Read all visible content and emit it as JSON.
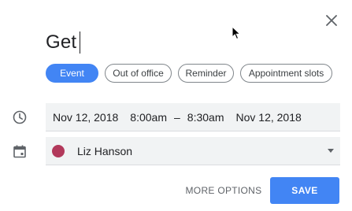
{
  "header": {
    "close_icon": "close-icon"
  },
  "event": {
    "title": "Get"
  },
  "event_types": [
    {
      "label": "Event",
      "active": true
    },
    {
      "label": "Out of office",
      "active": false
    },
    {
      "label": "Reminder",
      "active": false
    },
    {
      "label": "Appointment slots",
      "active": false
    }
  ],
  "datetime": {
    "icon": "clock-icon",
    "start_date": "Nov 12, 2018",
    "start_time": "8:00am",
    "separator": "–",
    "end_time": "8:30am",
    "end_date": "Nov 12, 2018"
  },
  "calendar": {
    "icon": "calendar-icon",
    "name": "Liz Hanson",
    "color": "#b2395b"
  },
  "actions": {
    "more_options": "MORE OPTIONS",
    "save": "SAVE"
  },
  "colors": {
    "accent": "#4285f4",
    "field_bg": "#f1f3f4"
  }
}
